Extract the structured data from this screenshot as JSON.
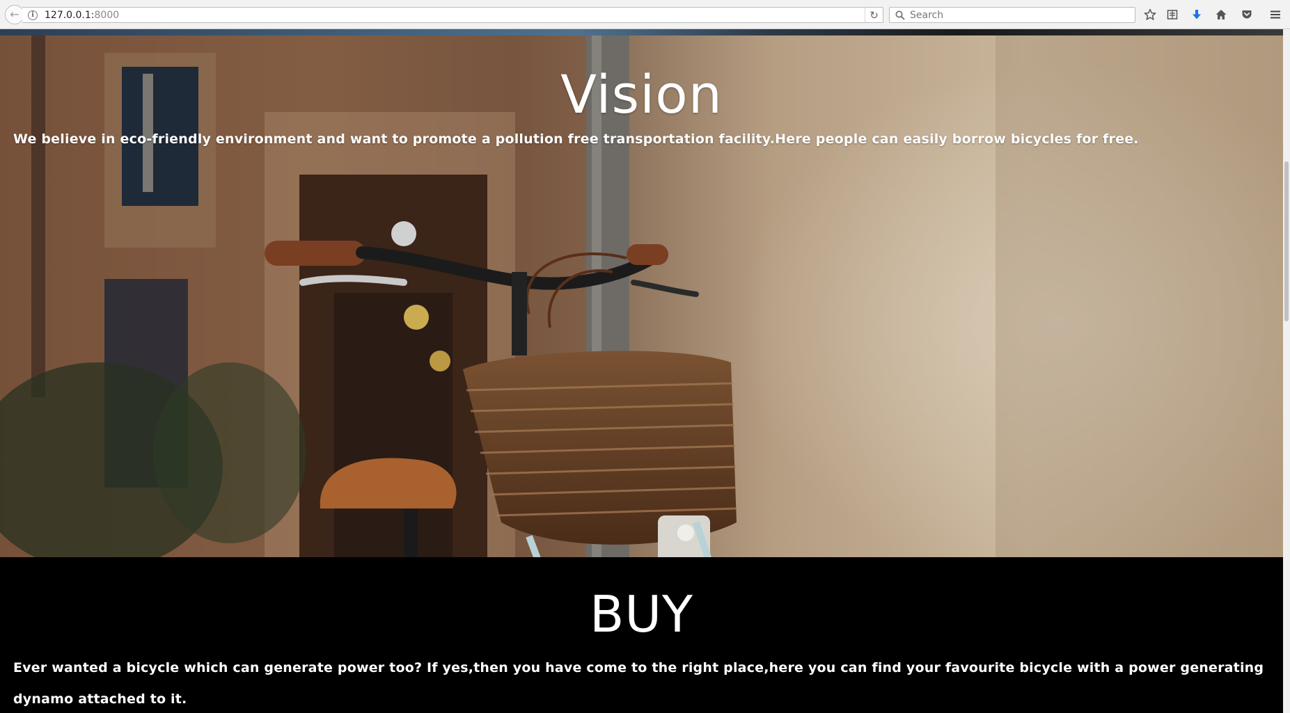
{
  "browser": {
    "url_host": "127.0.0.1:",
    "url_port": "8000",
    "search_placeholder": "Search"
  },
  "vision": {
    "title": "Vision",
    "text": "We believe in eco-friendly environment and want to promote a pollution free transportation facility.Here people can easily borrow bicycles for free."
  },
  "buy": {
    "title": "BUY",
    "text": "Ever wanted a bicycle which can generate power too? If yes,then you have come to the right place,here you can find your favourite bicycle with a power generating dynamo attached to it."
  },
  "colors": {
    "download_arrow": "#1a73e8",
    "section_background": "#000000",
    "text": "#ffffff"
  }
}
